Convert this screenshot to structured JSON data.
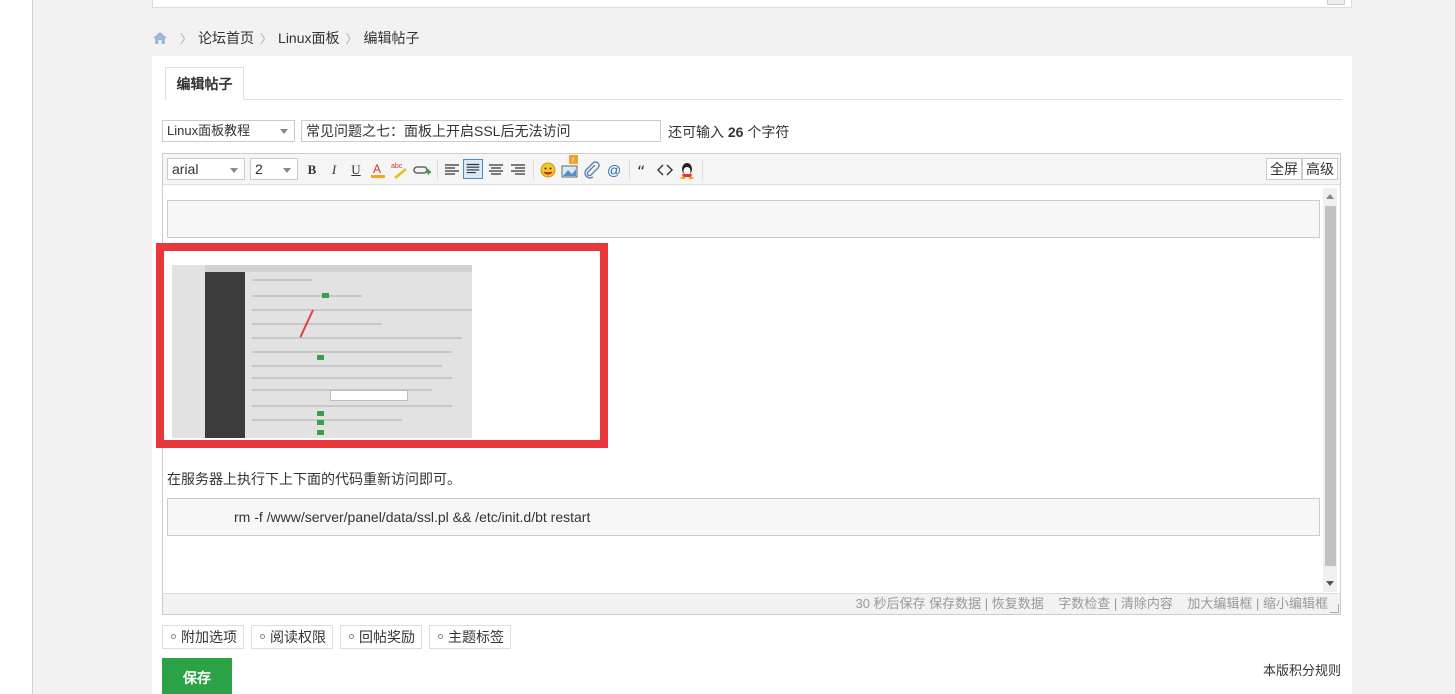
{
  "breadcrumb": {
    "items": [
      "论坛首页",
      "Linux面板",
      "编辑帖子"
    ]
  },
  "tab": {
    "label": "编辑帖子"
  },
  "post": {
    "type_selected": "Linux面板教程",
    "subject": "常见问题之七：面板上开启SSL后无法访问",
    "char_prefix": "还可输入",
    "char_remaining": "26",
    "char_suffix": "个字符"
  },
  "toolbar": {
    "font_family": "arial",
    "font_size": "2",
    "bold": "B",
    "italic": "I",
    "underline": "U",
    "fullscreen_label": "全屏",
    "advanced_label": "高级"
  },
  "content": {
    "instruction": "在服务器上执行下上下面的代码重新访问即可。",
    "code": "rm -f /www/server/panel/data/ssl.pl && /etc/init.d/bt restart"
  },
  "statusbar": {
    "autosave": "30 秒后保存",
    "save_data": "保存数据",
    "restore_data": "恢复数据",
    "word_check": "字数检查",
    "clear_content": "清除内容",
    "enlarge": "加大编辑框",
    "shrink": "缩小编辑框"
  },
  "options": [
    "附加选项",
    "阅读权限",
    "回帖奖励",
    "主题标签"
  ],
  "save_label": "保存",
  "rules_label": "本版积分规则",
  "colors": {
    "accent_green": "#2ba245",
    "highlight_red": "#e8383c",
    "selected_blue": "#4a8bc9"
  }
}
